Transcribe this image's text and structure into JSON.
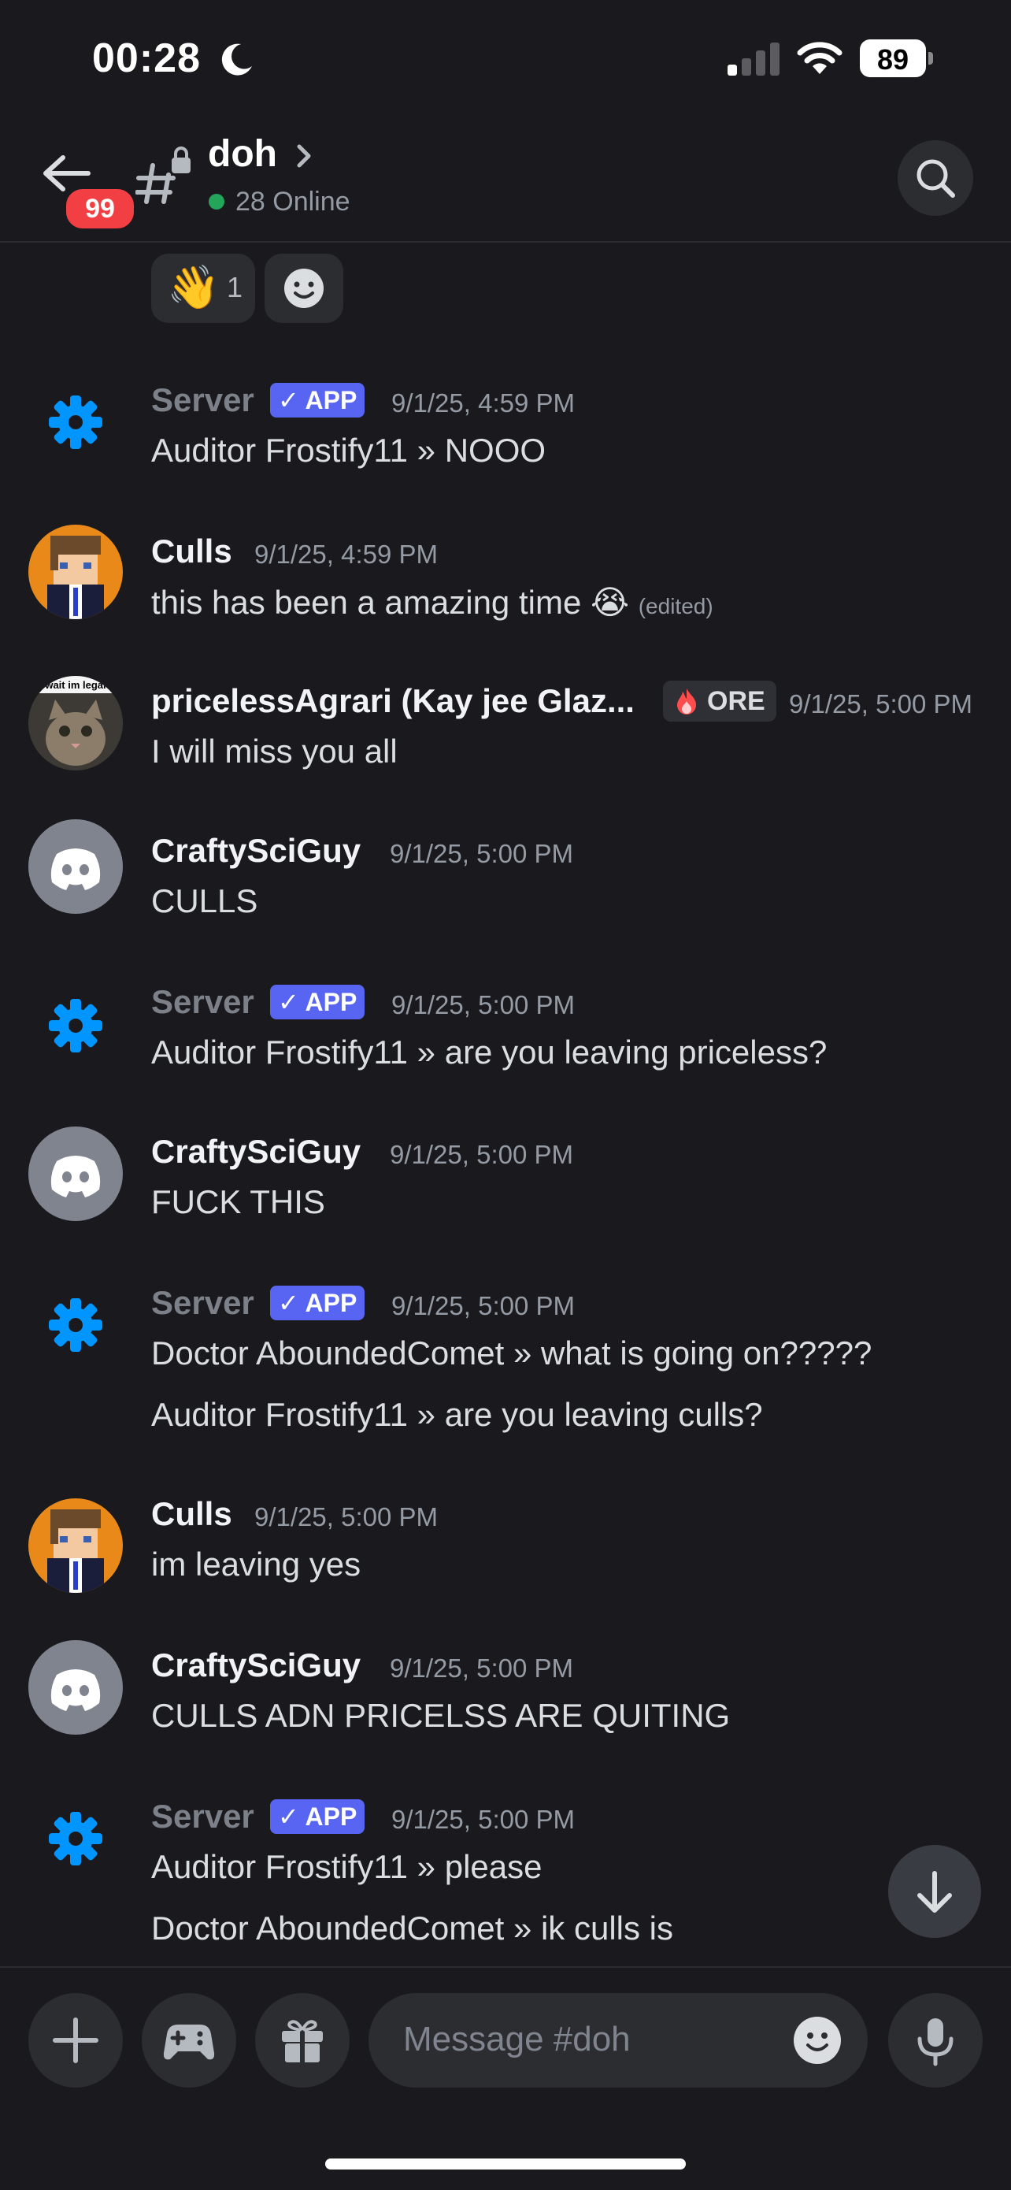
{
  "status_bar": {
    "time": "00:28",
    "battery": "89"
  },
  "header": {
    "back_badge": "99",
    "channel_name": "doh",
    "online": "28 Online"
  },
  "reactions": [
    {
      "emoji": "👋",
      "count": "1"
    }
  ],
  "messages": [
    {
      "author": "Server",
      "badge": "✓ APP",
      "timestamp": "9/1/25, 4:59 PM",
      "lines": [
        "Auditor Frostify11 » NOOO"
      ]
    },
    {
      "author": "Culls",
      "timestamp": "9/1/25, 4:59 PM",
      "lines": [
        "this has been a amazing time 😭"
      ],
      "edited": "(edited)"
    },
    {
      "author": "pricelessAgrari (Kay jee Glaz...",
      "role": "ORE",
      "avatar_caption": "wait im legal",
      "timestamp": "9/1/25, 5:00 PM",
      "lines": [
        "I will miss you all"
      ]
    },
    {
      "author": "CraftySciGuy",
      "timestamp": "9/1/25, 5:00 PM",
      "lines": [
        "CULLS"
      ]
    },
    {
      "author": "Server",
      "badge": "✓ APP",
      "timestamp": "9/1/25, 5:00 PM",
      "lines": [
        "Auditor Frostify11 » are you leaving priceless?"
      ]
    },
    {
      "author": "CraftySciGuy",
      "timestamp": "9/1/25, 5:00 PM",
      "lines": [
        "FUCK THIS"
      ]
    },
    {
      "author": "Server",
      "badge": "✓ APP",
      "timestamp": "9/1/25, 5:00 PM",
      "lines": [
        "Doctor AboundedComet » what is going on?????",
        "Auditor Frostify11 » are you leaving culls?"
      ]
    },
    {
      "author": "Culls",
      "timestamp": "9/1/25, 5:00 PM",
      "lines": [
        "im leaving yes"
      ]
    },
    {
      "author": "CraftySciGuy",
      "timestamp": "9/1/25, 5:00 PM",
      "lines": [
        "CULLS ADN PRICELSS ARE QUITING"
      ]
    },
    {
      "author": "Server",
      "badge": "✓ APP",
      "timestamp": "9/1/25, 5:00 PM",
      "lines": [
        "Auditor Frostify11 » please",
        "Doctor AboundedComet » ik culls is"
      ]
    }
  ],
  "composer": {
    "placeholder": "Message #doh"
  },
  "icons": {
    "back": "arrow-left-icon",
    "channel": "locked-hash-icon",
    "search": "search-icon",
    "gear": "gear-icon",
    "discord": "discord-logo-icon",
    "scroll": "arrow-down-icon",
    "plus": "plus-icon",
    "game": "gamepad-icon",
    "gift": "gift-icon",
    "emoji": "smiley-icon",
    "mic": "microphone-icon"
  },
  "colors": {
    "background": "#1a1a1e",
    "app_badge": "#5865f2",
    "online": "#23a55a",
    "notif": "#f23f43",
    "gear": "#0095ff"
  }
}
